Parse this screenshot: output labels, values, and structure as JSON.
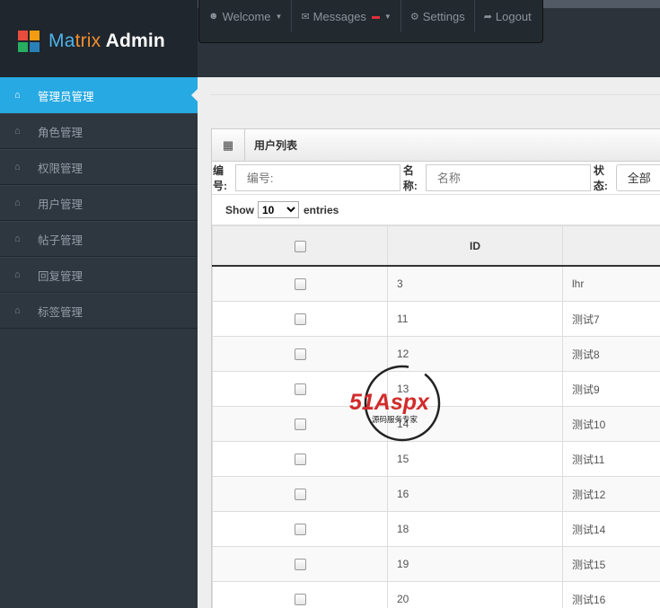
{
  "brand": {
    "part1": "Ma",
    "part2": "trix",
    "part3": " Admin"
  },
  "usernav": {
    "welcome": "Welcome",
    "messages": "Messages",
    "settings": "Settings",
    "logout": "Logout"
  },
  "sidebar": {
    "items": [
      {
        "label": "管理员管理"
      },
      {
        "label": "角色管理"
      },
      {
        "label": "权限管理"
      },
      {
        "label": "用户管理"
      },
      {
        "label": "帖子管理"
      },
      {
        "label": "回复管理"
      },
      {
        "label": "标签管理"
      }
    ]
  },
  "widget": {
    "title": "用户列表"
  },
  "filter": {
    "id_label": "编号:",
    "id_placeholder": "编号:",
    "name_label": "名称:",
    "name_placeholder": "名称",
    "status_label": "状态:",
    "status_value": "全部"
  },
  "length": {
    "show": "Show",
    "value": "10",
    "entries": "entries"
  },
  "table": {
    "headers": [
      "",
      "ID",
      ""
    ],
    "rows": [
      {
        "id": "3",
        "name": "lhr"
      },
      {
        "id": "11",
        "name": "测试7"
      },
      {
        "id": "12",
        "name": "测试8"
      },
      {
        "id": "13",
        "name": "测试9"
      },
      {
        "id": "14",
        "name": "测试10"
      },
      {
        "id": "15",
        "name": "测试11"
      },
      {
        "id": "16",
        "name": "测试12"
      },
      {
        "id": "18",
        "name": "测试14"
      },
      {
        "id": "19",
        "name": "测试15"
      },
      {
        "id": "20",
        "name": "测试16"
      }
    ]
  },
  "watermark": {
    "brand": "51Aspx",
    "slogan": "源码服务专家"
  },
  "colors": {
    "accent": "#27a9e3",
    "sidebar": "#2e363f",
    "header": "#1f262d",
    "badge": "#e0303b"
  }
}
